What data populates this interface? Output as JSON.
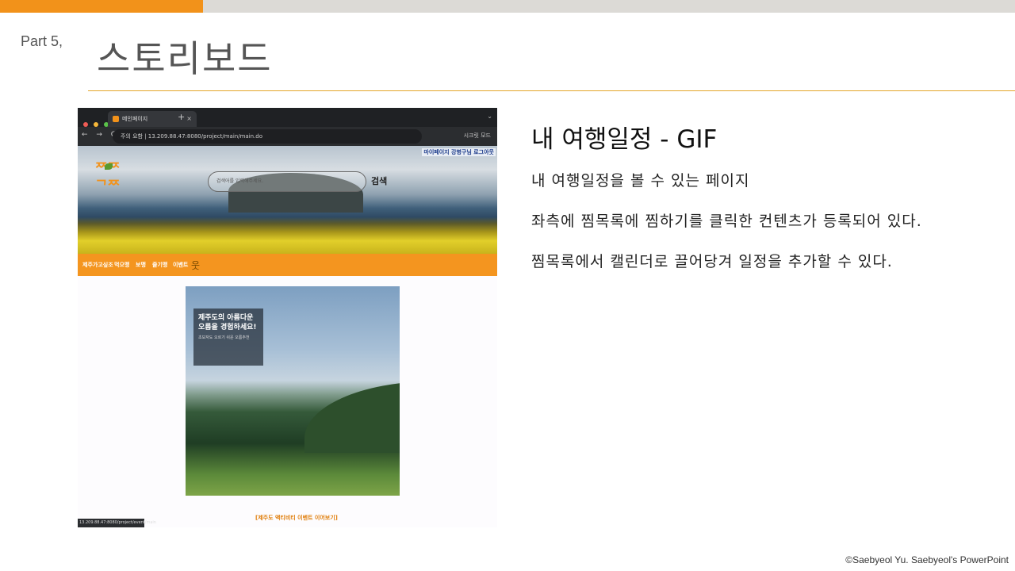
{
  "slide": {
    "part_label": "Part  5,",
    "title": "스토리보드",
    "copyright": "©Saebyeol Yu. Saebyeol's PowerPoint",
    "accent_color": "#f2921a",
    "rule_color": "#e3a629"
  },
  "content": {
    "heading": "내 여행일정 - GIF",
    "lines": [
      "내 여행일정을 볼 수 있는 페이지",
      "좌측에 찜목록에 찜하기를 클릭한 컨텐츠가 등록되어 있다.",
      "찜목록에서 캘린더로 끌어당겨 일정을 추가할 수 있다."
    ]
  },
  "screenshot": {
    "browser": {
      "tab_title": "메인페이지",
      "tab_close": "×",
      "new_tab": "+",
      "url": "주의 요함 | 13.209.88.47:8080/project/main/main.do",
      "nav_buttons": "← → C",
      "right_controls": "시크릿 모드",
      "status_url": "13.209.88.47:8080/project/event/main"
    },
    "site": {
      "top_links": "마이페이지  강병구님 로그아웃",
      "logo_text": [
        "ᄍᄍ",
        "ᄀᄍ"
      ],
      "search_placeholder": "검색어를 입력해주세요.",
      "search_button": "검색",
      "menu": [
        "제주가고싶조",
        "먹으맹",
        "보맹",
        "즐기맹",
        "이벤트"
      ],
      "promo_title": "제주도의 아름다운 오름을 경험하세요!",
      "promo_subtitle": "초보자도 오르기 쉬운 오름추천",
      "more_link": "[제주도 액티비티 이벤트 이어보기]"
    }
  }
}
